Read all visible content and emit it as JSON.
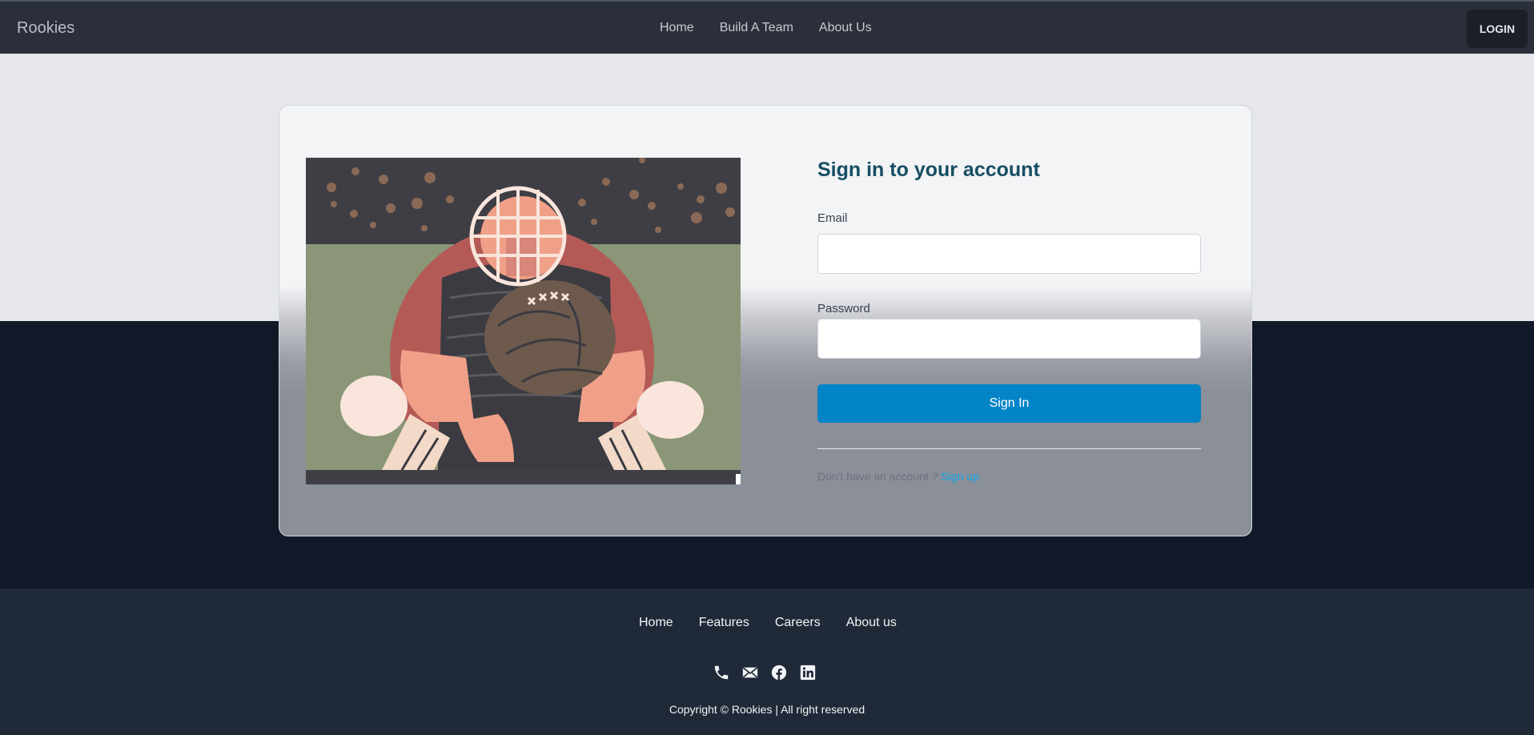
{
  "navbar": {
    "brand": "Rookies",
    "links": [
      "Home",
      "Build A Team",
      "About Us"
    ],
    "login_label": "LOGIN"
  },
  "login_form": {
    "title": "Sign in to your account",
    "email_label": "Email",
    "email_value": "",
    "password_label": "Password",
    "password_value": "",
    "submit_label": "Sign In",
    "signup_prompt": "Don't have an account ? ",
    "signup_link": "Sign up"
  },
  "illustration": {
    "icon": "baseball-catcher-illustration"
  },
  "footer": {
    "links": [
      "Home",
      "Features",
      "Careers",
      "About us"
    ],
    "icons": [
      "phone-icon",
      "mail-icon",
      "facebook-icon",
      "linkedin-icon"
    ],
    "copyright": "Copyright © Rookies | All right reserved"
  },
  "colors": {
    "navbar_bg": "#2a2f3a",
    "accent_button": "#0284c7",
    "title": "#164e63",
    "footer_bg": "#1f2937"
  }
}
